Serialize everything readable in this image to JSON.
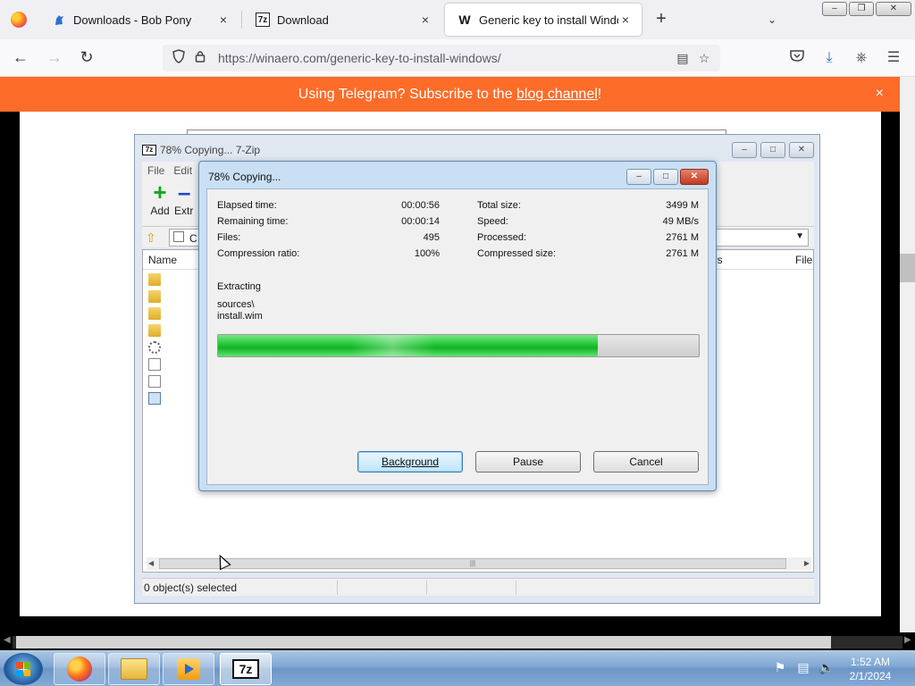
{
  "browser": {
    "tabs": [
      {
        "title": "Downloads - Bob Pony",
        "icon": "bob-pony-icon"
      },
      {
        "title": "Download",
        "icon": "7zip-icon",
        "favicon_text": "7z"
      },
      {
        "title": "Generic key to install Windows",
        "icon": "winaero-icon",
        "favicon_text": "W",
        "active": true
      }
    ],
    "new_tab_symbol": "+",
    "url": "https://winaero.com/generic-key-to-install-windows/"
  },
  "banner": {
    "text_before": "Using Telegram? Subscribe to the ",
    "link": "blog channel",
    "text_after": "!",
    "close_symbol": "×",
    "color": "#fd6c28"
  },
  "zip_main": {
    "title": "78% Copying... 7-Zip",
    "title_icon_text": "7z",
    "menu": [
      "File",
      "Edit"
    ],
    "toolbar": {
      "add_label": "Add",
      "extract_label": "Extr"
    },
    "address_text": "C",
    "columns": {
      "name": "Name",
      "others": "ers",
      "file": "File"
    },
    "status": "0 object(s) selected"
  },
  "dialog": {
    "title": "78% Copying...",
    "elapsed_label": "Elapsed time:",
    "elapsed_value": "00:00:56",
    "remaining_label": "Remaining time:",
    "remaining_value": "00:00:14",
    "files_label": "Files:",
    "files_value": "495",
    "ratio_label": "Compression ratio:",
    "ratio_value": "100%",
    "total_label": "Total size:",
    "total_value": "3499 M",
    "speed_label": "Speed:",
    "speed_value": "49 MB/s",
    "processed_label": "Processed:",
    "processed_value": "2761 M",
    "compressed_label": "Compressed size:",
    "compressed_value": "2761 M",
    "operation": "Extracting",
    "path_line1": "sources\\",
    "path_line2": "install.wim",
    "progress_fraction": 0.79,
    "buttons": {
      "background": "Background",
      "pause": "Pause",
      "cancel": "Cancel"
    }
  },
  "taskbar": {
    "apps": [
      "firefox-icon",
      "explorer-folder-icon",
      "media-player-icon",
      "7zip-icon"
    ],
    "app_7z_text": "7z",
    "time": "1:52 AM",
    "date": "2/1/2024"
  }
}
